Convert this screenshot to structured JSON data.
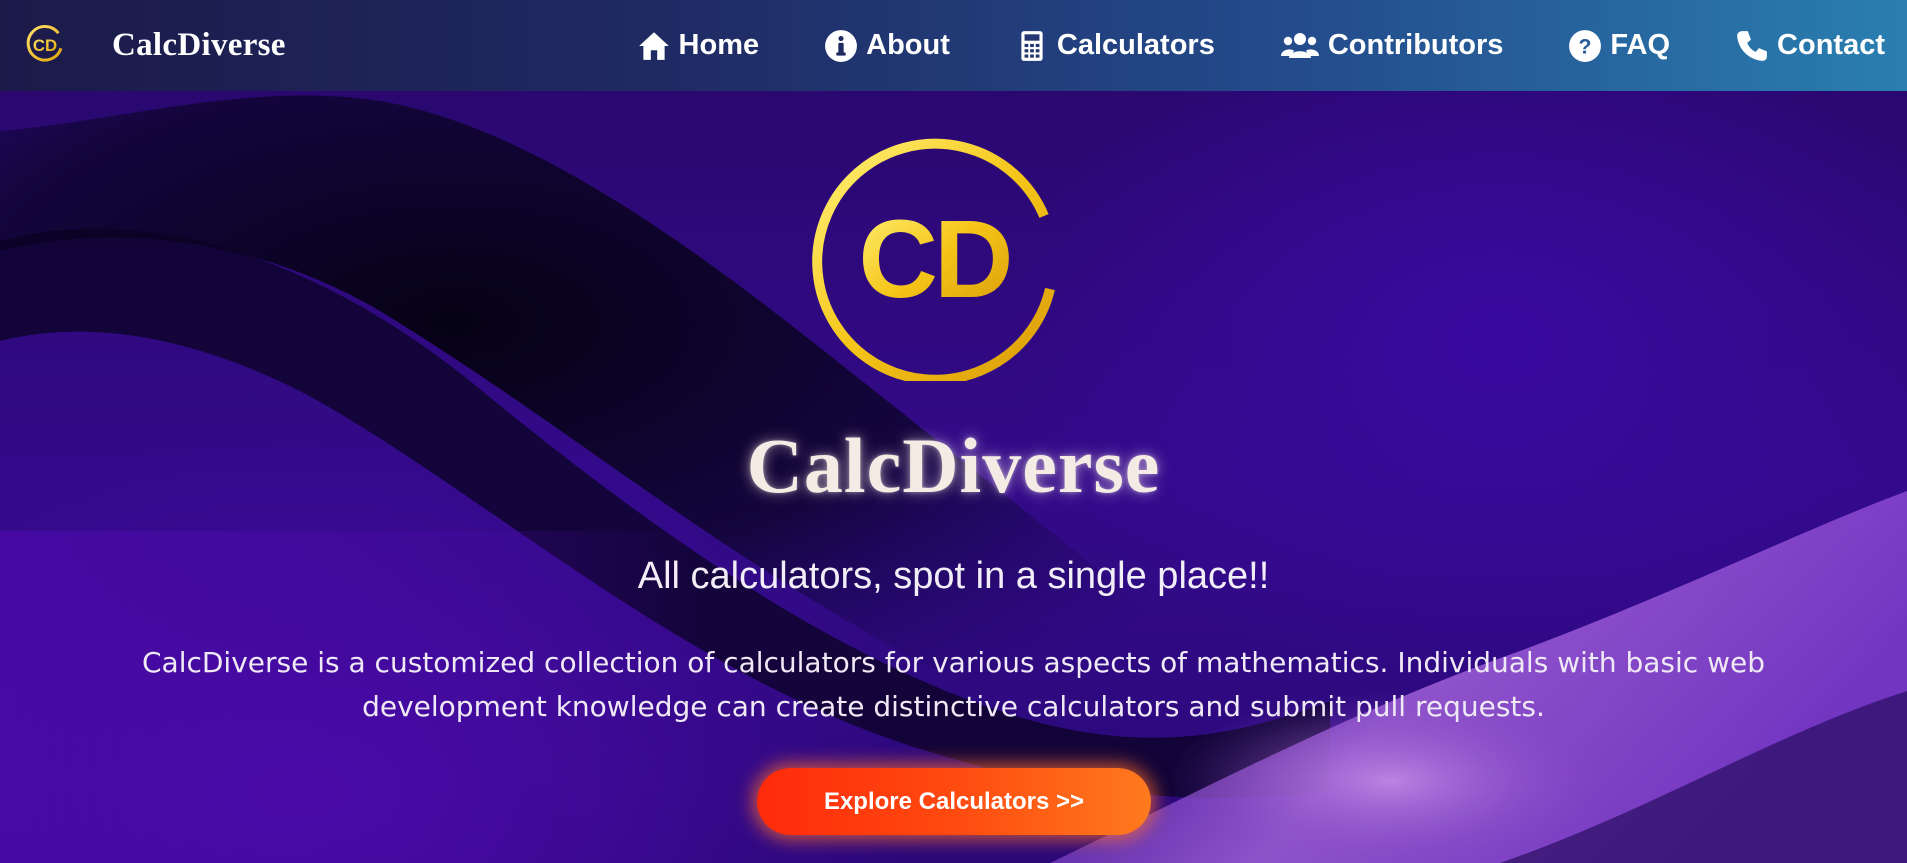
{
  "brand": {
    "name": "CalcDiverse",
    "logo_text": "CD"
  },
  "nav": {
    "items": [
      {
        "label": "Home",
        "icon": "home-icon"
      },
      {
        "label": "About",
        "icon": "info-icon"
      },
      {
        "label": "Calculators",
        "icon": "calculator-icon"
      },
      {
        "label": "Contributors",
        "icon": "users-icon"
      },
      {
        "label": "FAQ",
        "icon": "question-icon"
      },
      {
        "label": "Contact",
        "icon": "phone-icon"
      }
    ]
  },
  "hero": {
    "logo_text": "CD",
    "title": "CalcDiverse",
    "tagline": "All calculators, spot in a single place!!",
    "description": "CalcDiverse is a customized collection of calculators for various aspects of mathematics. Individuals with basic web development knowledge can create distinctive calculators and submit pull requests.",
    "cta_label": "Explore Calculators >>"
  },
  "colors": {
    "logo_gold": "#f5c518",
    "cta_orange": "#ff4a10",
    "navbar_start": "#1c1a49",
    "navbar_end": "#2a7fb0",
    "hero_purple": "#330a8a"
  }
}
